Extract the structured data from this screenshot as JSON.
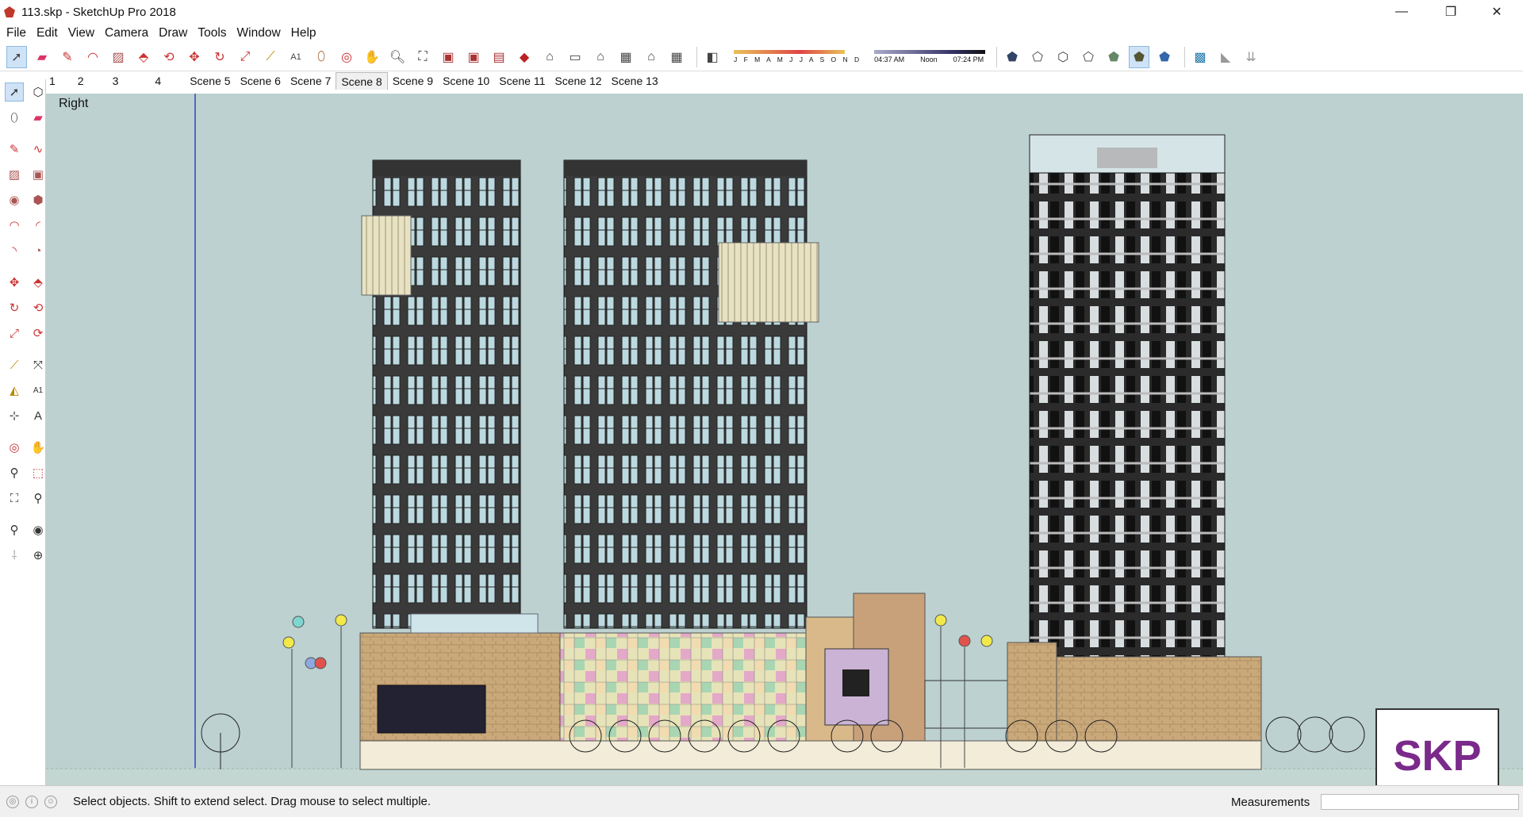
{
  "window": {
    "title": "113.skp - SketchUp Pro 2018",
    "minimize": "—",
    "maximize": "❐",
    "close": "✕"
  },
  "menu": [
    "File",
    "Edit",
    "View",
    "Camera",
    "Draw",
    "Tools",
    "Window",
    "Help"
  ],
  "toolbar": {
    "icons": [
      "select-icon",
      "eraser-icon",
      "pencil-icon",
      "arc-icon",
      "rectangle-icon",
      "push-pull-icon",
      "follow-me-icon",
      "move-icon",
      "rotate-icon",
      "scale-icon",
      "tape-icon",
      "text-icon",
      "paint-icon",
      "orbit-icon",
      "pan-icon",
      "zoom-icon",
      "zoom-extents-icon",
      "warehouse-icon",
      "extension-icon",
      "layout-icon",
      "ruby-icon",
      "iso-view-icon",
      "top-view-icon",
      "front-view-icon",
      "right-view-icon",
      "back-view-icon",
      "left-view-icon",
      "shadows-icon"
    ],
    "months": "J F M A M J J A S O N D",
    "time_start": "04:37 AM",
    "time_mid": "Noon",
    "time_end": "07:24 PM",
    "style_icons": [
      "xray-icon",
      "back-edges-icon",
      "wireframe-icon",
      "hidden-line-icon",
      "shaded-icon",
      "shaded-texture-icon",
      "monochrome-icon",
      "section-plane-icon",
      "section-cut-icon",
      "section-fill-icon"
    ]
  },
  "scenes": [
    "1",
    "2",
    "3",
    "4",
    "Scene 5",
    "Scene 6",
    "Scene 7",
    "Scene 8",
    "Scene 9",
    "Scene 10",
    "Scene 11",
    "Scene 12",
    "Scene 13"
  ],
  "active_scene": "Scene 8",
  "viewport": {
    "view_label": "Right",
    "background": "#bcd1d0"
  },
  "status": {
    "hint": "Select objects. Shift to extend select. Drag mouse to select multiple.",
    "measurements_label": "Measurements",
    "measurements_value": ""
  },
  "watermark": "SKP"
}
